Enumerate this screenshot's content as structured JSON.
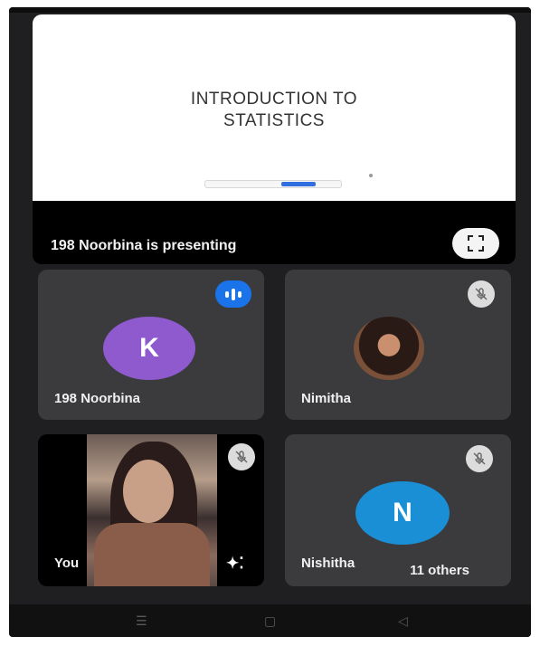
{
  "presentation": {
    "slide_title_line1": "INTRODUCTION TO",
    "slide_title_line2": "STATISTICS",
    "presenter_label": "198 Noorbina is presenting"
  },
  "participants": [
    {
      "name": "198 Noorbina",
      "initial": "K",
      "avatar_color": "#8e5acd",
      "status": "speaking"
    },
    {
      "name": "Nimitha",
      "status": "muted"
    },
    {
      "name": "You",
      "status": "muted"
    },
    {
      "name": "Nishitha",
      "initial": "N",
      "avatar_color": "#1a8fd6",
      "status": "muted"
    }
  ],
  "others_label": "11 others",
  "colors": {
    "background": "#1f1f21",
    "tile": "#3b3b3e",
    "speaking_blue": "#1a73e8"
  }
}
